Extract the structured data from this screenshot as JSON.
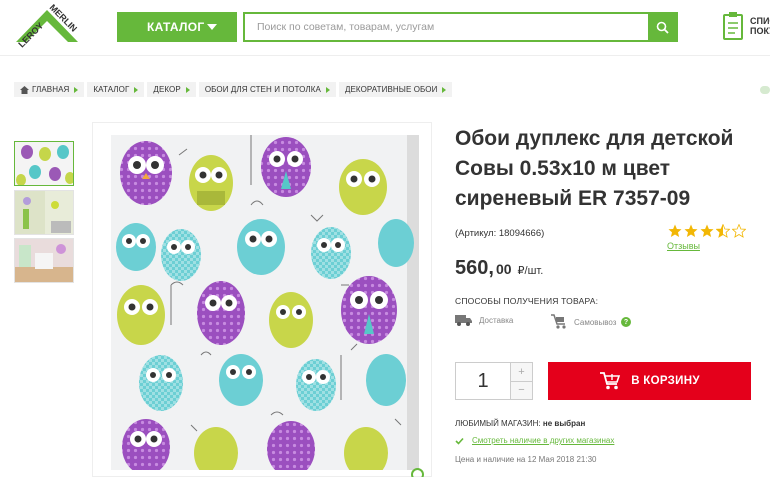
{
  "header": {
    "logo_text": "LEROY MERLIN",
    "catalog_label": "КАТАЛОГ",
    "search_placeholder": "Поиск по советам, товарам, услугам",
    "clip_line1": "СПИС",
    "clip_line2": "ПОКУ"
  },
  "breadcrumb": [
    "ГЛАВНАЯ",
    "КАТАЛОГ",
    "ДЕКОР",
    "ОБОИ ДЛЯ СТЕН И ПОТОЛКА",
    "ДЕКОРАТИВНЫЕ ОБОИ"
  ],
  "product": {
    "title_line1": "Обои дуплекс для детской",
    "title_line2": "Совы 0.53х10 м цвет",
    "title_line3": "сиреневый ER 7357-09",
    "article": "(Артикул: 18094666)",
    "rating": 3.5,
    "reviews_label": "Отзывы",
    "price_main": "560,",
    "price_cents": "00",
    "price_unit": "₽/шт.",
    "methods_title": "СПОСОБЫ ПОЛУЧЕНИЯ ТОВАРА:",
    "delivery_label": "Доставка",
    "pickup_label": "Самовывоз",
    "info_mark": "?",
    "quantity": "1",
    "qty_plus": "+",
    "qty_minus": "−",
    "cart_label": "В КОРЗИНУ",
    "fav_store_label": "ЛЮБИМЫЙ МАГАЗИН:",
    "fav_store_value": "не выбран",
    "availability_link": "Смотреть наличие в других магазинах",
    "price_date": "Цена и наличие на 12 Мая 2018 21:30"
  },
  "colors": {
    "brand_green": "#66b83b",
    "cart_red": "#e4001b",
    "star_gold": "#f2b705"
  }
}
